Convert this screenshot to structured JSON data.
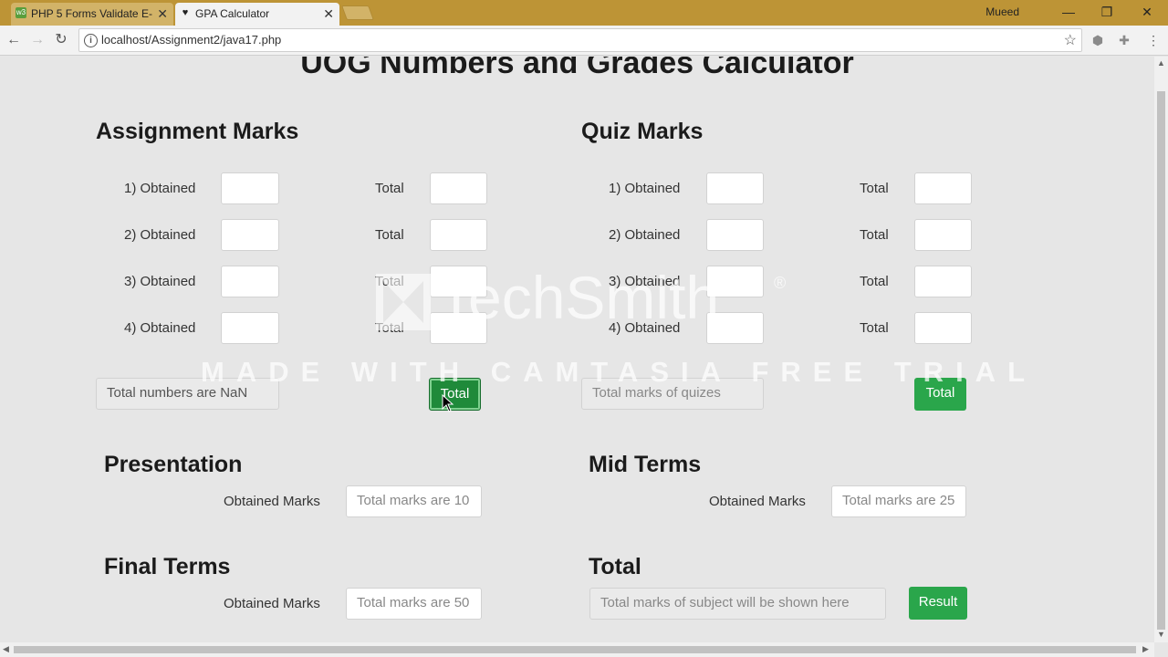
{
  "browser": {
    "tabs": [
      {
        "title": "PHP 5 Forms Validate E-",
        "active": false,
        "favicon": "w3-icon"
      },
      {
        "title": "GPA Calculator",
        "active": true,
        "favicon": "heart-icon"
      }
    ],
    "user": "Mueed",
    "url": "localhost/Assignment2/java17.php"
  },
  "page": {
    "title": "UOG Numbers and Grades Calculator",
    "assignment": {
      "heading": "Assignment Marks",
      "rows": [
        {
          "obtained_label": "1) Obtained",
          "total_label": "Total"
        },
        {
          "obtained_label": "2) Obtained",
          "total_label": "Total"
        },
        {
          "obtained_label": "3) Obtained",
          "total_label": "Total"
        },
        {
          "obtained_label": "4) Obtained",
          "total_label": "Total"
        }
      ],
      "result_value": "Total numbers are NaN",
      "button": "Total"
    },
    "quiz": {
      "heading": "Quiz Marks",
      "rows": [
        {
          "obtained_label": "1) Obtained",
          "total_label": "Total"
        },
        {
          "obtained_label": "2) Obtained",
          "total_label": "Total"
        },
        {
          "obtained_label": "3) Obtained",
          "total_label": "Total"
        },
        {
          "obtained_label": "4) Obtained",
          "total_label": "Total"
        }
      ],
      "result_placeholder": "Total marks of quizes",
      "button": "Total"
    },
    "presentation": {
      "heading": "Presentation",
      "label": "Obtained Marks",
      "placeholder": "Total marks are 10"
    },
    "midterms": {
      "heading": "Mid Terms",
      "label": "Obtained Marks",
      "placeholder": "Total marks are 25"
    },
    "finalterms": {
      "heading": "Final Terms",
      "label": "Obtained Marks",
      "placeholder": "Total marks are 50"
    },
    "total": {
      "heading": "Total",
      "placeholder": "Total marks of subject will be shown here",
      "button": "Result"
    }
  },
  "watermark": {
    "brand": "TechSmith",
    "registered": "®",
    "banner": "MADE WITH CAMTASIA FREE TRIAL"
  },
  "colors": {
    "titlebar": "#bd9436",
    "button_green": "#2aa64b",
    "page_bg": "#e6e6e6"
  }
}
